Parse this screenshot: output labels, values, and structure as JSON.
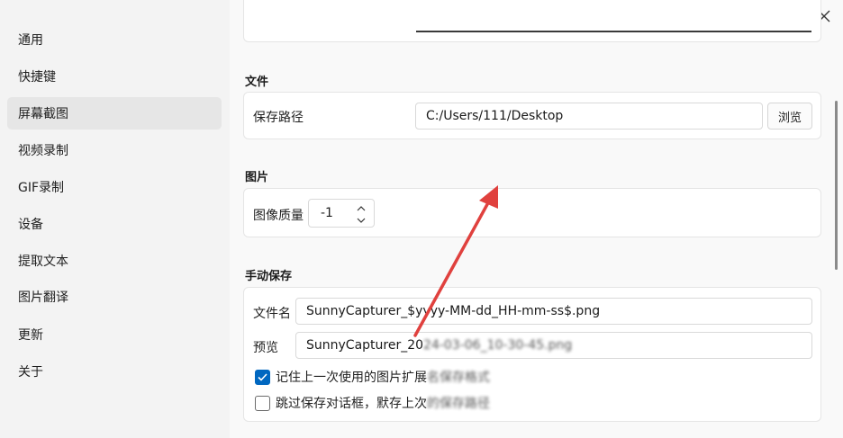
{
  "sidebar": {
    "items": [
      {
        "label": "通用"
      },
      {
        "label": "快捷键"
      },
      {
        "label": "屏幕截图",
        "active": true
      },
      {
        "label": "视频录制"
      },
      {
        "label": "GIF录制"
      },
      {
        "label": "设备"
      },
      {
        "label": "提取文本"
      },
      {
        "label": "图片翻译"
      },
      {
        "label": "更新"
      },
      {
        "label": "关于"
      }
    ]
  },
  "file_section": {
    "title": "文件",
    "save_path_label": "保存路径",
    "save_path_value": "C:/Users/111/Desktop",
    "browse_label": "浏览"
  },
  "image_section": {
    "title": "图片",
    "quality_label": "图像质量",
    "quality_value": "-1"
  },
  "manual_save_section": {
    "title": "手动保存",
    "filename_label": "文件名",
    "filename_value": "SunnyCapturer_$yyyy-MM-dd_HH-mm-ss$.png",
    "preview_label": "预览",
    "preview_value": "SunnyCapturer_20",
    "preview_value_obscured": "24-03-06_10-30-45.png",
    "remember_ext_label": "记住上一次使用的图片扩展",
    "remember_ext_obscured": "名保存格式",
    "remember_ext_checked": true,
    "skip_dialog_label": "跳过保存对话框，默存上次",
    "skip_dialog_obscured": "的保存路径",
    "skip_dialog_checked": false
  },
  "icons": {
    "close": "close-icon",
    "check": "check-icon",
    "up": "chevron-up-icon",
    "down": "chevron-down-icon"
  },
  "colors": {
    "accent": "#0067c0",
    "annotation_arrow": "#e0413e"
  }
}
